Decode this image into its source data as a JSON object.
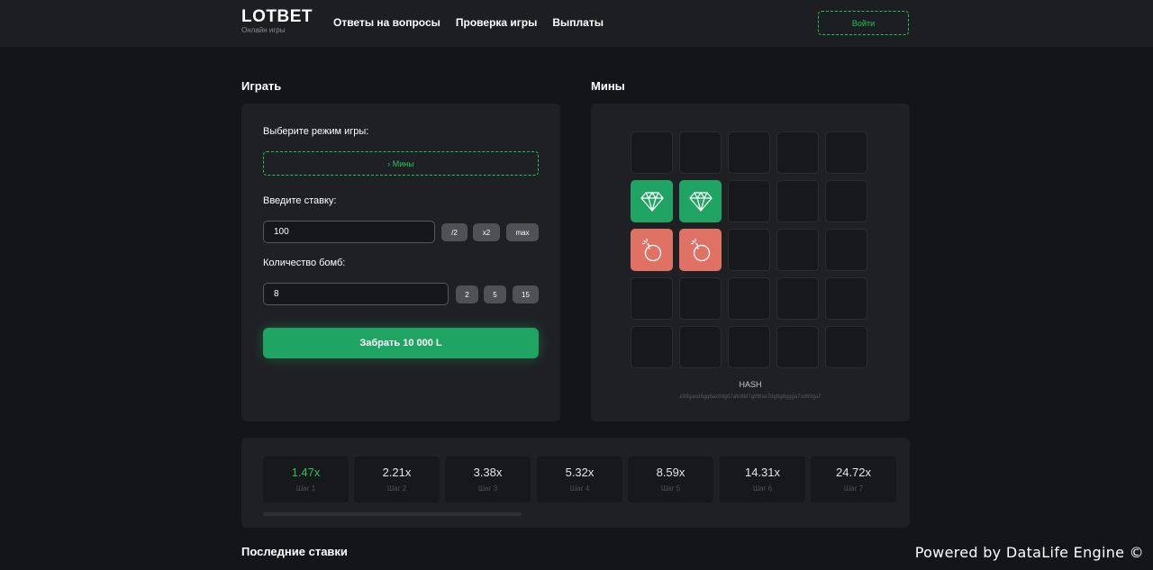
{
  "header": {
    "logo": "LOTBET",
    "logo_sub": "Онлайн игры",
    "nav": [
      "Ответы на вопросы",
      "Проверка игры",
      "Выплаты"
    ],
    "login": "Войти"
  },
  "play": {
    "title": "Играть",
    "mode_label": "Выберите режим игры:",
    "mode_value": "› Мины",
    "bet_label": "Введите ставку:",
    "bet_value": "100",
    "bet_chips": [
      "/2",
      "x2",
      "max"
    ],
    "bombs_label": "Количество бомб:",
    "bombs_value": "8",
    "bombs_chips": [
      "2",
      "5",
      "15"
    ],
    "cashout": "Забрать 10 000 L"
  },
  "mines": {
    "title": "Мины",
    "cells": [
      "empty",
      "empty",
      "empty",
      "empty",
      "empty",
      "gem",
      "gem",
      "empty",
      "empty",
      "empty",
      "bomb",
      "bomb",
      "empty",
      "empty",
      "empty",
      "empty",
      "empty",
      "empty",
      "empty",
      "empty",
      "empty",
      "empty",
      "empty",
      "empty",
      "empty"
    ],
    "hash_label": "HASH",
    "hash_value": "e99gaxd6gg6ax8dg67a9d8d7g9f6ax7dg9g8ggga7sd89ga7"
  },
  "steps": [
    {
      "mult": "1.47x",
      "label": "Шаг 1",
      "active": true
    },
    {
      "mult": "2.21x",
      "label": "Шаг 2",
      "active": false
    },
    {
      "mult": "3.38x",
      "label": "Шаг 3",
      "active": false
    },
    {
      "mult": "5.32x",
      "label": "Шаг 4",
      "active": false
    },
    {
      "mult": "8.59x",
      "label": "Шаг 5",
      "active": false
    },
    {
      "mult": "14.31x",
      "label": "Шаг 6",
      "active": false
    },
    {
      "mult": "24.72x",
      "label": "Шаг 7",
      "active": false
    }
  ],
  "recent_bets_title": "Последние ставки",
  "footer": "Powered by DataLife Engine ©",
  "colors": {
    "accent": "#1fc45a",
    "gem": "#1fa463",
    "bomb": "#e07265"
  }
}
